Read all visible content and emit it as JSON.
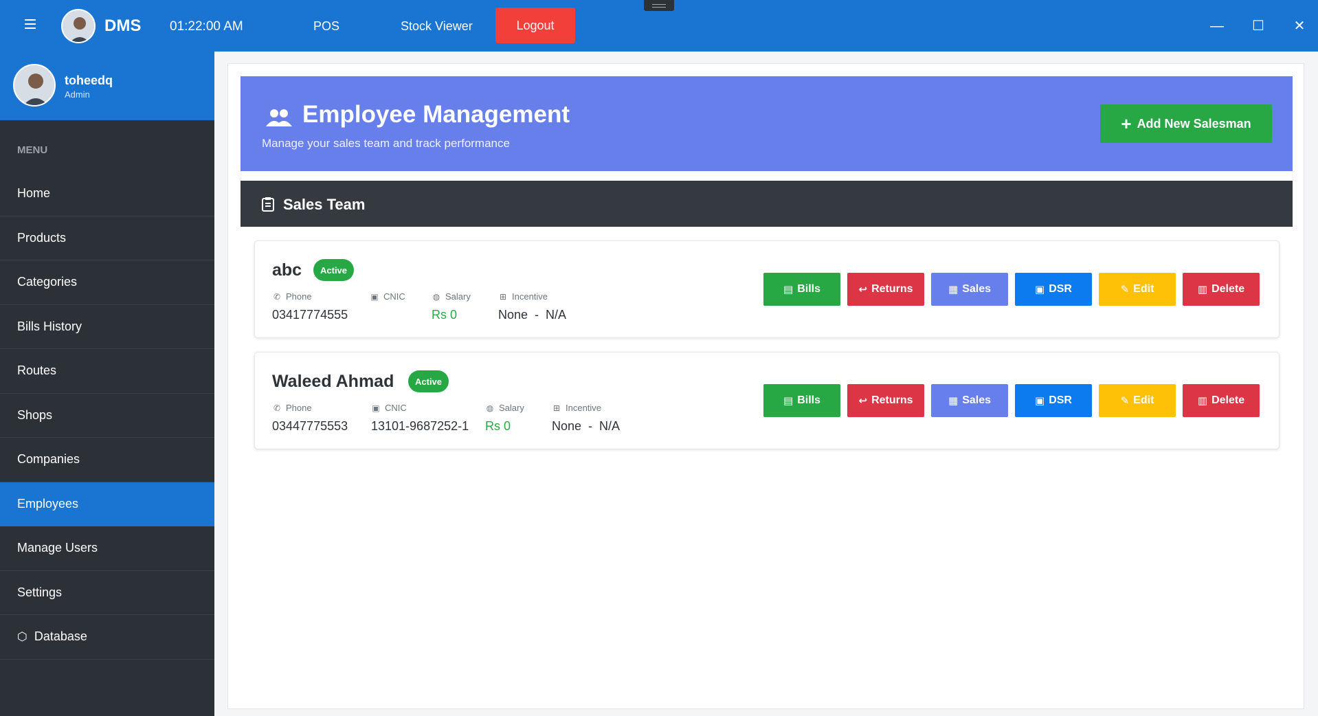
{
  "topbar": {
    "app_name": "DMS",
    "clock": "01:22:00 AM",
    "nav": {
      "pos": "POS",
      "stock_viewer": "Stock Viewer"
    },
    "logout": "Logout",
    "window_controls": {
      "minimize": "—",
      "maximize": "☐",
      "close": "✕"
    },
    "colors": {
      "bar": "#1a74d2",
      "logout": "#f23f3a"
    }
  },
  "profile": {
    "username": "toheedq",
    "role": "Admin"
  },
  "sidebar": {
    "menu_label": "MENU",
    "items": [
      {
        "label": "Home"
      },
      {
        "label": "Products"
      },
      {
        "label": "Categories"
      },
      {
        "label": "Bills History"
      },
      {
        "label": "Routes"
      },
      {
        "label": "Shops"
      },
      {
        "label": "Companies"
      },
      {
        "label": "Employees",
        "active": true
      },
      {
        "label": "Manage Users"
      },
      {
        "label": "Settings"
      },
      {
        "label": "Database",
        "icon": "cube-icon"
      }
    ]
  },
  "hero": {
    "title": "Employee Management",
    "subtitle": "Manage your sales team and track performance",
    "add_button": "Add New Salesman",
    "colors": {
      "background": "#677fea",
      "add_button": "#28a745"
    }
  },
  "team": {
    "title": "Sales Team",
    "field_labels": {
      "phone": "Phone",
      "cnic": "CNIC",
      "salary": "Salary",
      "incentive": "Incentive"
    },
    "actions": {
      "bills": "Bills",
      "returns": "Returns",
      "sales": "Sales",
      "dsr": "DSR",
      "edit": "Edit",
      "delete": "Delete"
    },
    "employees": [
      {
        "name": "abc",
        "status": "Active",
        "phone": "03417774555",
        "cnic": "",
        "salary": "Rs 0",
        "incentive": "None  -  N/A"
      },
      {
        "name": "Waleed Ahmad",
        "status": "Active",
        "phone": "03447775553",
        "cnic": "13101-9687252-1",
        "salary": "Rs 0",
        "incentive": "None  -  N/A"
      }
    ]
  }
}
